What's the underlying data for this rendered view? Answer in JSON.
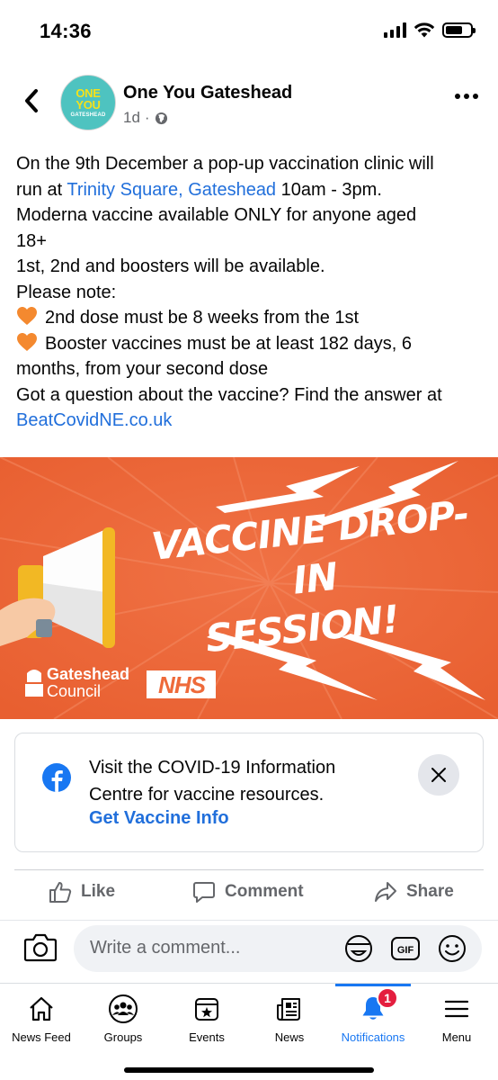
{
  "status_bar": {
    "time": "14:36"
  },
  "post": {
    "page_name": "One You Gateshead",
    "age": "1d",
    "separator": "·",
    "avatar": {
      "line1": "ONE",
      "line2": "YOU",
      "line3": "GATESHEAD"
    },
    "text": {
      "l1": "On the 9th December a pop-up vaccination clinic will",
      "l2_pre": "run at ",
      "l2_link": "Trinity Square, Gateshead",
      "l2_post": " 10am - 3pm.",
      "l3": "Moderna vaccine available ONLY for anyone aged",
      "l4": "18+",
      "l5": "1st, 2nd and boosters will be available.",
      "l6": "Please note:",
      "l7": "2nd dose must be 8 weeks from the 1st",
      "l8": "Booster vaccines must be at least 182 days, 6",
      "l9": "months, from your second dose",
      "l10": "Got a question about the vaccine? Find the answer at",
      "l11_link": "BeatCovidNE.co.uk"
    },
    "banner": {
      "title_line1": "VACCINE DROP-IN",
      "title_line2": "SESSION!",
      "council_line1": "Gateshead",
      "council_line2": "Council",
      "nhs": "NHS",
      "bg_color": "#ee6a3a"
    }
  },
  "info_card": {
    "text": "Visit the COVID-19 Information Centre for vaccine resources.",
    "link": "Get Vaccine Info"
  },
  "actions": {
    "like": "Like",
    "comment": "Comment",
    "share": "Share"
  },
  "comment_box": {
    "placeholder": "Write a comment..."
  },
  "tabbar": {
    "tabs": [
      {
        "label": "News Feed",
        "icon": "home-icon"
      },
      {
        "label": "Groups",
        "icon": "groups-icon"
      },
      {
        "label": "Events",
        "icon": "calendar-icon"
      },
      {
        "label": "News",
        "icon": "newspaper-icon"
      },
      {
        "label": "Notifications",
        "icon": "bell-icon",
        "badge": "1"
      },
      {
        "label": "Menu",
        "icon": "hamburger-icon"
      }
    ],
    "active": "Notifications"
  },
  "colors": {
    "link": "#216fdb",
    "facebook_blue": "#1877f2",
    "badge_red": "#e41e3f"
  }
}
